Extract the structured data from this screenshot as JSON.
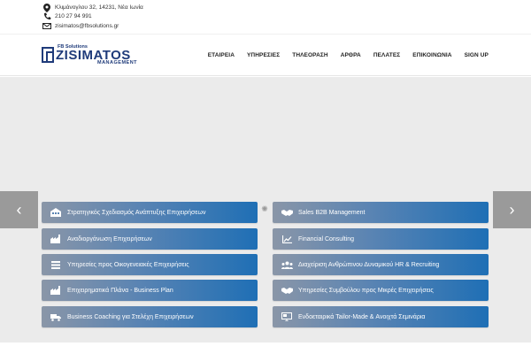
{
  "contact": {
    "address": "Κλιμάνογλου 32, 14231, Νέα Ιωνία",
    "phone": "210 27 94 991",
    "email": "zisimatos@fbsolutions.gr"
  },
  "logo": {
    "small_text": "FB Solutions",
    "big_text": "ZISIMATOS",
    "sub_text": "MANAGEMENT"
  },
  "nav": {
    "items": [
      "ΕΤΑΙΡΕΙΑ",
      "ΥΠΗΡΕΣΙΕΣ",
      "ΤΗΛΕΟΡΑΣΗ",
      "ΑΡΘΡΑ",
      "ΠΕΛΑΤΕΣ",
      "ΕΠΙΚΟΙΝΩΝΙΑ",
      "SIGN UP"
    ]
  },
  "slider": {
    "prev_arrow": "‹",
    "next_arrow": "›",
    "loading_glyph": "✺"
  },
  "services": {
    "left": [
      "Στρατηγικός Σχεδιασμός Ανάπτυξης Επιχειρήσεων",
      "Αναδιοργάνωση Επιχειρήσεων",
      "Υπηρεσίες προς Οικογενειακές Επιχειρήσεις",
      "Επιχειρηματικά Πλάνα - Business Plan",
      "Business Coaching για Στελέχη Επιχειρήσεων"
    ],
    "right": [
      "Sales B2B Management",
      "Financial Consulting",
      "Διαχείριση Ανθρώπινου Δυναμικού HR & Recruiting",
      "Υπηρεσίες Συμβούλου προς Μικρές Επιχειρήσεις",
      "Ενδοεταιρικά Tailor-Made & Ανοιχτά Σεμινάρια"
    ]
  },
  "colors": {
    "brand": "#1f3b7a",
    "button_start": "#8a96a8",
    "button_end": "#1f6fb5",
    "hero_bg": "#ebebeb",
    "arrow_bg": "#9a9a9a"
  }
}
